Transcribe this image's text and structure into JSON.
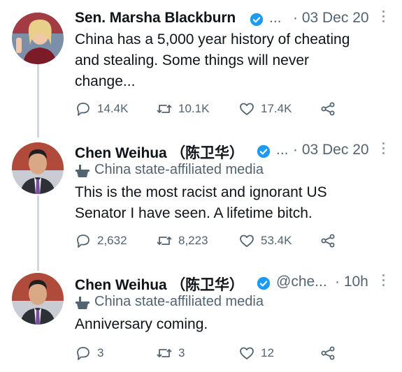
{
  "tweets": [
    {
      "name": "Sen. Marsha Blackburn",
      "handle": "...",
      "time": "· 03 Dec 20",
      "affiliation": "",
      "text_lines": [
        "China has a 5,000 year history of cheating",
        "and stealing. Some things will never",
        "change..."
      ],
      "replies": "14.4K",
      "retweets": "10.1K",
      "likes": "17.4K"
    },
    {
      "name": "Chen Weihua （陈卫华）",
      "handle": "...",
      "time": "· 03 Dec 20",
      "affiliation": "China state-affiliated media",
      "text_lines": [
        "This is the most racist and ignorant US",
        "Senator I have seen.  A lifetime bitch."
      ],
      "replies": "2,632",
      "retweets": "8,223",
      "likes": "53.4K"
    },
    {
      "name": "Chen Weihua （陈卫华）",
      "handle": "@che...",
      "time": "· 10h",
      "affiliation": "China state-affiliated media",
      "text_lines": [
        "Anniversary coming."
      ],
      "replies": "3",
      "retweets": "3",
      "likes": "12"
    }
  ],
  "colors": {
    "text": "#0f1419",
    "muted": "#536471",
    "verified": "#1d9bf0",
    "thread_line": "#cfd9de"
  },
  "icons": [
    "reply-icon",
    "retweet-icon",
    "like-icon",
    "share-icon",
    "verified-icon",
    "more-icon",
    "affiliation-icon"
  ]
}
